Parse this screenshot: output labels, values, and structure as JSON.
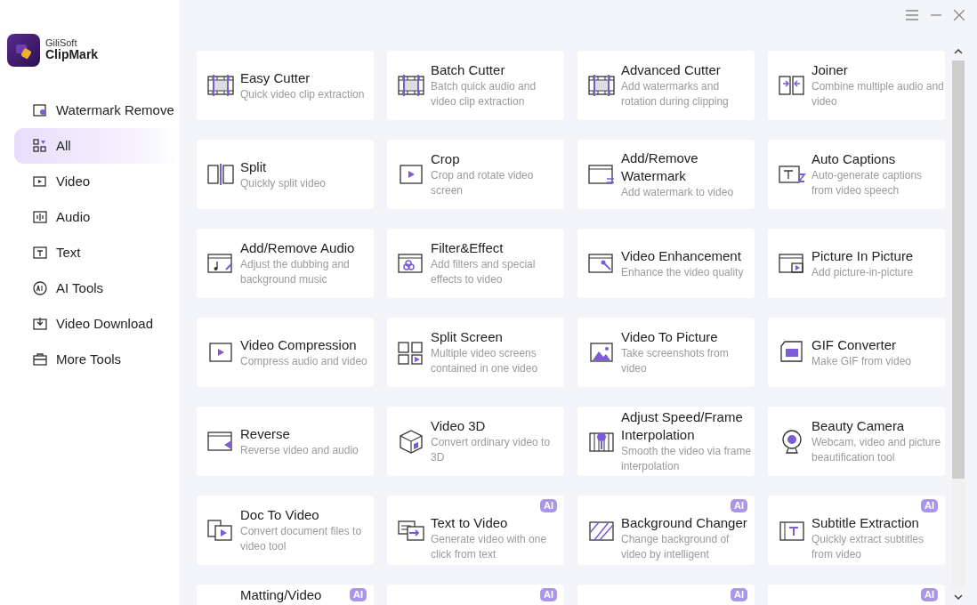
{
  "app": {
    "brand_small": "GiliSoft",
    "brand_name": "ClipMark"
  },
  "sidebar": {
    "items": [
      {
        "label": "Watermark Remove",
        "selected": false
      },
      {
        "label": "All",
        "selected": true
      },
      {
        "label": "Video",
        "selected": false
      },
      {
        "label": "Audio",
        "selected": false
      },
      {
        "label": "Text",
        "selected": false
      },
      {
        "label": "AI Tools",
        "selected": false
      },
      {
        "label": "Video Download",
        "selected": false
      },
      {
        "label": "More Tools",
        "selected": false
      }
    ]
  },
  "tools": [
    {
      "title": "Easy Cutter",
      "description": "Quick video clip extraction"
    },
    {
      "title": "Batch Cutter",
      "description": "Batch quick audio and video clip extraction"
    },
    {
      "title": "Advanced Cutter",
      "description": "Add watermarks and rotation during clipping"
    },
    {
      "title": "Joiner",
      "description": "Combine multiple audio and video"
    },
    {
      "title": "Split",
      "description": "Quickly split video"
    },
    {
      "title": "Crop",
      "description": "Crop and rotate video screen"
    },
    {
      "title": "Add/Remove Watermark",
      "description": "Add watermark to video"
    },
    {
      "title": "Auto Captions",
      "description": "Auto-generate captions from video speech"
    },
    {
      "title": "Add/Remove Audio",
      "description": "Adjust the dubbing and background music"
    },
    {
      "title": "Filter&Effect",
      "description": "Add filters and special effects to video"
    },
    {
      "title": "Video Enhancement",
      "description": "Enhance the video quality"
    },
    {
      "title": "Picture In Picture",
      "description": "Add picture-in-picture"
    },
    {
      "title": "Video Compression",
      "description": "Compress audio and video"
    },
    {
      "title": "Split Screen",
      "description": "Multiple video screens contained in one video"
    },
    {
      "title": "Video To Picture",
      "description": "Take screenshots from video"
    },
    {
      "title": "GIF Converter",
      "description": "Make GIF from video"
    },
    {
      "title": "Reverse",
      "description": "Reverse video and audio"
    },
    {
      "title": "Video 3D",
      "description": "Convert ordinary video to 3D"
    },
    {
      "title": "Adjust Speed/Frame Interpolation",
      "description": "Smooth the video via frame interpolation"
    },
    {
      "title": "Beauty Camera",
      "description": "Webcam, video and picture beautification tool"
    },
    {
      "title": "Doc To Video",
      "description": "Convert document files to video tool"
    },
    {
      "title": "Text to Video",
      "description": "Generate video with one click from text",
      "badge": "AI"
    },
    {
      "title": "Background Changer",
      "description": "Change background of video by intelligent",
      "badge": "AI"
    },
    {
      "title": "Subtitle Extraction",
      "description": "Quickly extract subtitles from video",
      "badge": "AI"
    },
    {
      "title": "Matting/Video",
      "badge": "AI"
    },
    {
      "badge": "AI"
    },
    {
      "badge": "AI"
    },
    {
      "badge": "AI"
    }
  ]
}
